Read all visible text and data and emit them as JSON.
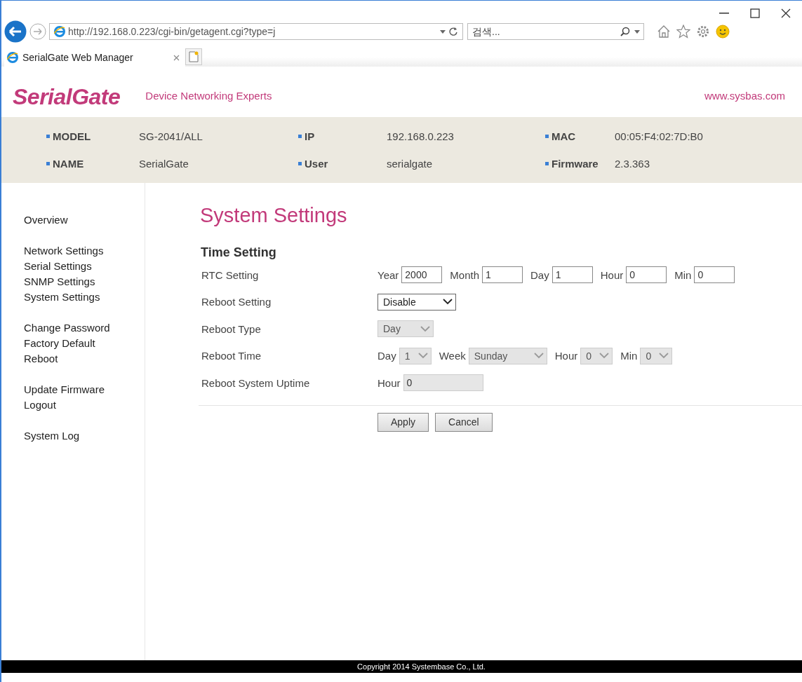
{
  "browser": {
    "address": "http://192.168.0.223/cgi-bin/getagent.cgi?type=j",
    "search_placeholder": "검색...",
    "tabs": [
      {
        "label": "SerialGate Web Manager",
        "selected": true
      }
    ]
  },
  "header": {
    "logo": "SerialGate",
    "tagline": "Device Networking Experts",
    "link": "www.sysbas.com"
  },
  "info": [
    [
      {
        "label": "MODEL",
        "value": "SG-2041/ALL"
      },
      {
        "label": "IP",
        "value": "192.168.0.223"
      },
      {
        "label": "MAC",
        "value": "00:05:F4:02:7D:B0"
      }
    ],
    [
      {
        "label": "NAME",
        "value": "SerialGate"
      },
      {
        "label": "User",
        "value": "serialgate"
      },
      {
        "label": "Firmware",
        "value": "2.3.363"
      }
    ]
  ],
  "sidebar": {
    "groups": [
      [
        "Overview"
      ],
      [
        "Network Settings",
        "Serial Settings",
        "SNMP Settings",
        "System Settings"
      ],
      [
        "Change Password",
        "Factory Default",
        "Reboot"
      ],
      [
        "Update Firmware",
        "Logout"
      ],
      [
        "System Log"
      ]
    ]
  },
  "main": {
    "title": "System Settings",
    "section": "Time Setting",
    "rows": [
      {
        "label": "RTC Setting",
        "controls": [
          {
            "kind": "input",
            "label": "Year",
            "value": "2000",
            "disabled": false
          },
          {
            "kind": "input",
            "label": "Month",
            "value": "1",
            "disabled": false
          },
          {
            "kind": "input",
            "label": "Day",
            "value": "1",
            "disabled": false
          },
          {
            "kind": "input",
            "label": "Hour",
            "value": "0",
            "disabled": false
          },
          {
            "kind": "input",
            "label": "Min",
            "value": "0",
            "disabled": false
          }
        ]
      },
      {
        "label": "Reboot Setting",
        "controls": [
          {
            "kind": "select",
            "value": "Disable",
            "disabled": false
          }
        ]
      },
      {
        "label": "Reboot Type",
        "controls": [
          {
            "kind": "select",
            "value": "Day",
            "disabled": true
          }
        ]
      },
      {
        "label": "Reboot Time",
        "controls": [
          {
            "kind": "select",
            "label": "Day",
            "value": "1",
            "disabled": true
          },
          {
            "kind": "select",
            "label": "Week",
            "value": "Sunday",
            "disabled": true
          },
          {
            "kind": "select",
            "label": "Hour",
            "value": "0",
            "disabled": true
          },
          {
            "kind": "select",
            "label": "Min",
            "value": "0",
            "disabled": true
          }
        ]
      },
      {
        "label": "Reboot System Uptime",
        "controls": [
          {
            "kind": "input",
            "label": "Hour",
            "value": "0",
            "disabled": true
          }
        ]
      }
    ],
    "buttons": [
      "Apply",
      "Cancel"
    ]
  },
  "footer": "Copyright 2014 Systembase Co., Ltd."
}
